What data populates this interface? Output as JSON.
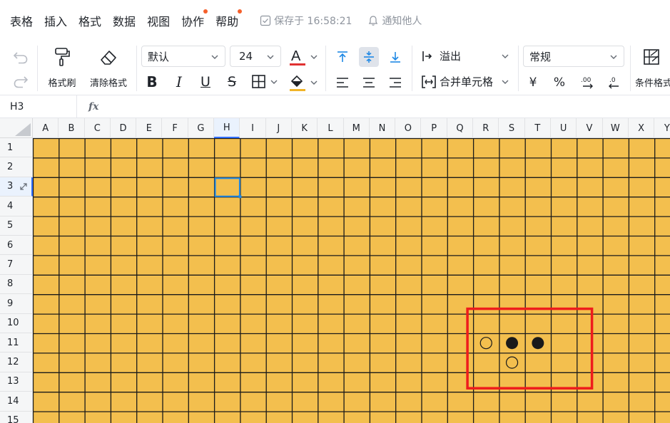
{
  "menu": {
    "items": [
      {
        "label": "表格",
        "dot": false
      },
      {
        "label": "插入",
        "dot": false
      },
      {
        "label": "格式",
        "dot": false
      },
      {
        "label": "数据",
        "dot": false
      },
      {
        "label": "视图",
        "dot": false
      },
      {
        "label": "协作",
        "dot": true
      },
      {
        "label": "帮助",
        "dot": true
      }
    ],
    "save_status": "保存于 16:58:21",
    "notify_label": "通知他人"
  },
  "toolbar": {
    "undo_icon": "undo-icon",
    "redo_icon": "redo-icon",
    "format_painter_label": "格式刷",
    "clear_format_label": "清除格式",
    "font_name": "默认",
    "font_size": "24",
    "font_color": "#e03131",
    "fill_color": "#f0b429",
    "overflow_label": "溢出",
    "merge_label": "合并单元格",
    "number_format": "常规",
    "currency_symbol": "¥",
    "percent_symbol": "%",
    "conditional_label": "条件格式"
  },
  "formula_bar": {
    "cell_ref": "H3",
    "fx_label": "fx",
    "value": ""
  },
  "sheet": {
    "columns": [
      "A",
      "B",
      "C",
      "D",
      "E",
      "F",
      "G",
      "H",
      "I",
      "J",
      "K",
      "L",
      "M",
      "N",
      "O",
      "P",
      "Q",
      "R",
      "S",
      "T",
      "U",
      "V",
      "W",
      "X",
      "Y"
    ],
    "rows": [
      "1",
      "2",
      "3",
      "4",
      "5",
      "6",
      "7",
      "8",
      "9",
      "10",
      "11",
      "12",
      "13",
      "14",
      "15"
    ],
    "selected_column": "H",
    "selected_row": "3",
    "board_color": "#f3bf4e",
    "line_color": "#1a1a1a",
    "selection_color": "#1e88e5",
    "highlight_color": "#ee1c1c",
    "stones": [
      {
        "col": "R",
        "row": "11",
        "color": "white"
      },
      {
        "col": "S",
        "row": "11",
        "color": "black"
      },
      {
        "col": "T",
        "row": "11",
        "color": "black"
      },
      {
        "col": "S",
        "row": "12",
        "color": "white"
      }
    ],
    "highlight_range": {
      "from_col": "R",
      "to_col": "V",
      "from_row": "10",
      "to_row": "13"
    }
  }
}
